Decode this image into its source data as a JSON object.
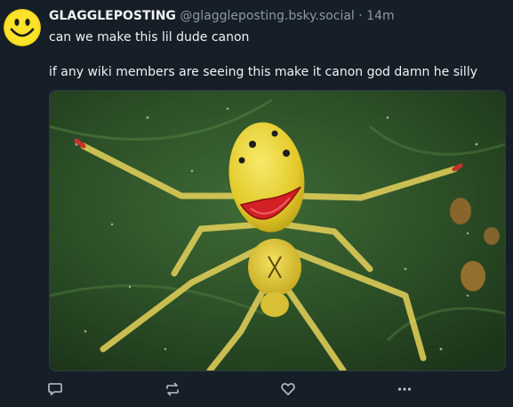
{
  "post": {
    "author": {
      "display_name": "GLAGGLEPOSTING",
      "handle": "@glaggleposting.bsky.social",
      "separator": "·",
      "time": "14m",
      "avatar_icon": "smiley-face-avatar"
    },
    "text_line_1": "can we make this lil dude canon",
    "text_line_2": "if any wiki members are seeing this make it canon god damn he silly",
    "image": {
      "subject": "yellow translucent spider with red smiley-face pattern on a green leaf"
    },
    "actions": [
      {
        "name": "reply",
        "icon": "reply-icon"
      },
      {
        "name": "repost",
        "icon": "repost-icon"
      },
      {
        "name": "like",
        "icon": "heart-icon"
      },
      {
        "name": "more",
        "icon": "more-icon"
      }
    ]
  },
  "colors": {
    "background": "#161e27",
    "text": "#f1f3f5",
    "muted": "#8b98a5",
    "icon": "#b8c2cc"
  }
}
